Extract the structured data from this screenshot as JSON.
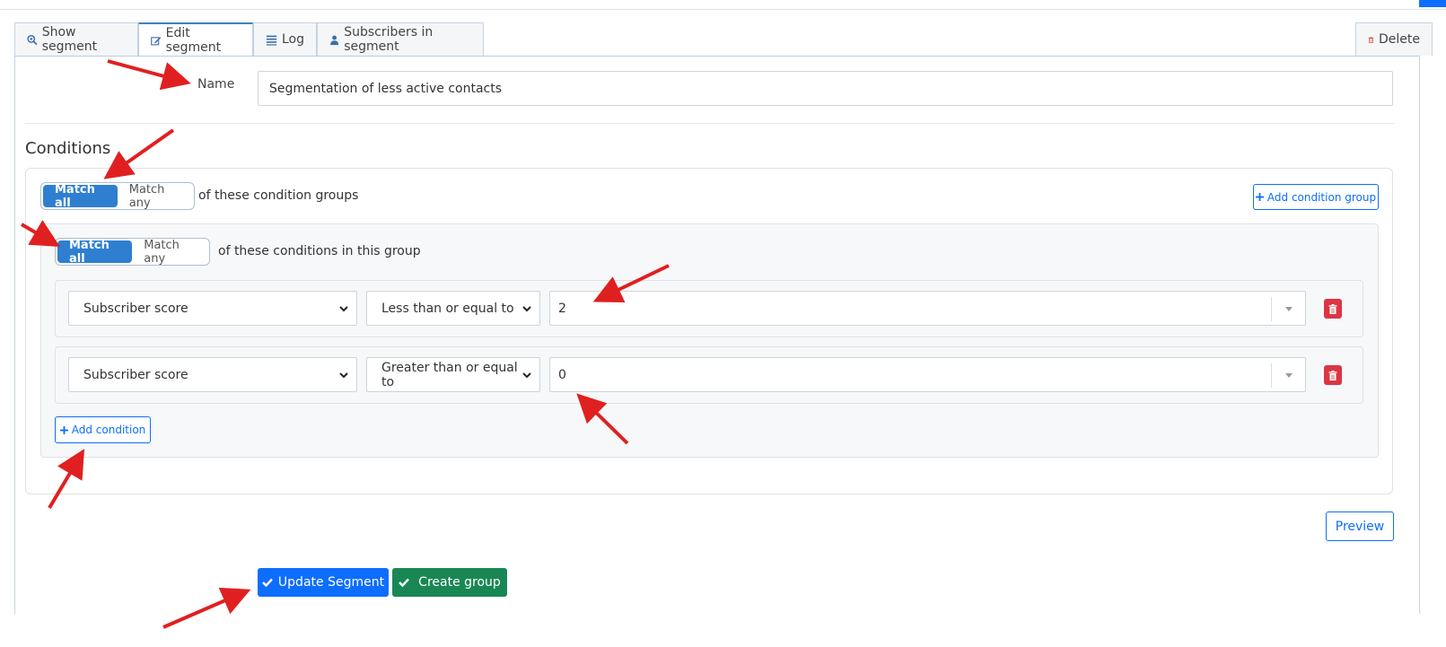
{
  "tabs": {
    "show": "Show segment",
    "edit": "Edit segment",
    "log": "Log",
    "subscribers": "Subscribers in segment",
    "delete": "Delete"
  },
  "form": {
    "name_label": "Name",
    "name_value": "Segmentation of less active contacts",
    "conditions_title": "Conditions"
  },
  "groups": {
    "match_all": "Match all",
    "match_any": "Match any",
    "selected": "Match all",
    "hint": "of these condition groups",
    "add_group": "Add condition group"
  },
  "group": {
    "match_all": "Match all",
    "match_any": "Match any",
    "selected": "Match all",
    "hint": "of these conditions in this group",
    "add_condition": "Add condition",
    "conditions": [
      {
        "field": "Subscriber score",
        "operator": "Less than or equal to",
        "value": "2"
      },
      {
        "field": "Subscriber score",
        "operator": "Greater than or equal to",
        "value": "0"
      }
    ]
  },
  "actions": {
    "preview": "Preview",
    "update": "Update Segment",
    "create_group": "Create group"
  },
  "colors": {
    "primary": "#0d6efd",
    "success": "#198754",
    "danger": "#dc3545",
    "toggle_active": "#2f7fd1",
    "annotation_arrow": "#e02020"
  }
}
